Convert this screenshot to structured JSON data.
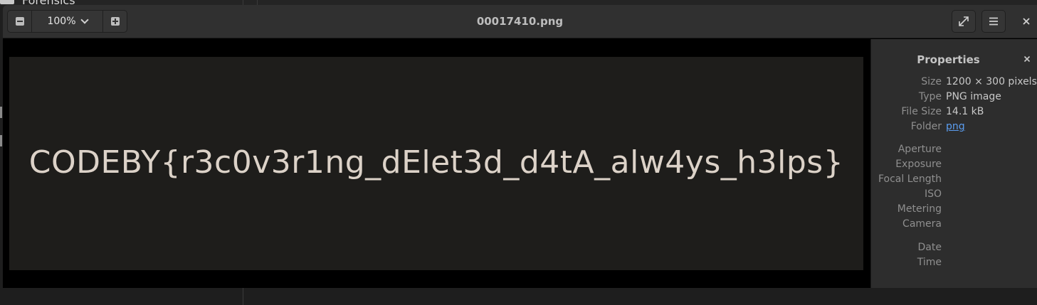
{
  "background": {
    "folder_label": "Forensics"
  },
  "viewer": {
    "zoom_level": "100%",
    "title": "00017410.png",
    "flag_text": "CODEBY{r3c0v3r1ng_dElet3d_d4tA_alw4ys_h3lps}",
    "icons": {
      "zoom_out": "zoom-out-icon",
      "zoom_in": "zoom-in-icon",
      "zoom_dropdown": "chevron-down-icon",
      "fullscreen": "fullscreen-icon",
      "menu": "hamburger-menu-icon",
      "close": "close-icon"
    }
  },
  "properties": {
    "title": "Properties",
    "rows": [
      {
        "label": "Size",
        "value": "1200 × 300 pixels"
      },
      {
        "label": "Type",
        "value": "PNG image"
      },
      {
        "label": "File Size",
        "value": "14.1 kB"
      },
      {
        "label": "Folder",
        "value": "png"
      }
    ],
    "exif_rows": [
      {
        "label": "Aperture",
        "value": ""
      },
      {
        "label": "Exposure",
        "value": ""
      },
      {
        "label": "Focal Length",
        "value": ""
      },
      {
        "label": "ISO",
        "value": ""
      },
      {
        "label": "Metering",
        "value": ""
      },
      {
        "label": "Camera",
        "value": ""
      }
    ],
    "date_rows": [
      {
        "label": "Date",
        "value": ""
      },
      {
        "label": "Time",
        "value": ""
      }
    ]
  },
  "colors": {
    "headerbar": "#303030",
    "sidebar": "#2d2d2d",
    "image_background": "#1e1d1b",
    "flag_text": "#dcd2c8",
    "link": "#5b9df0"
  }
}
